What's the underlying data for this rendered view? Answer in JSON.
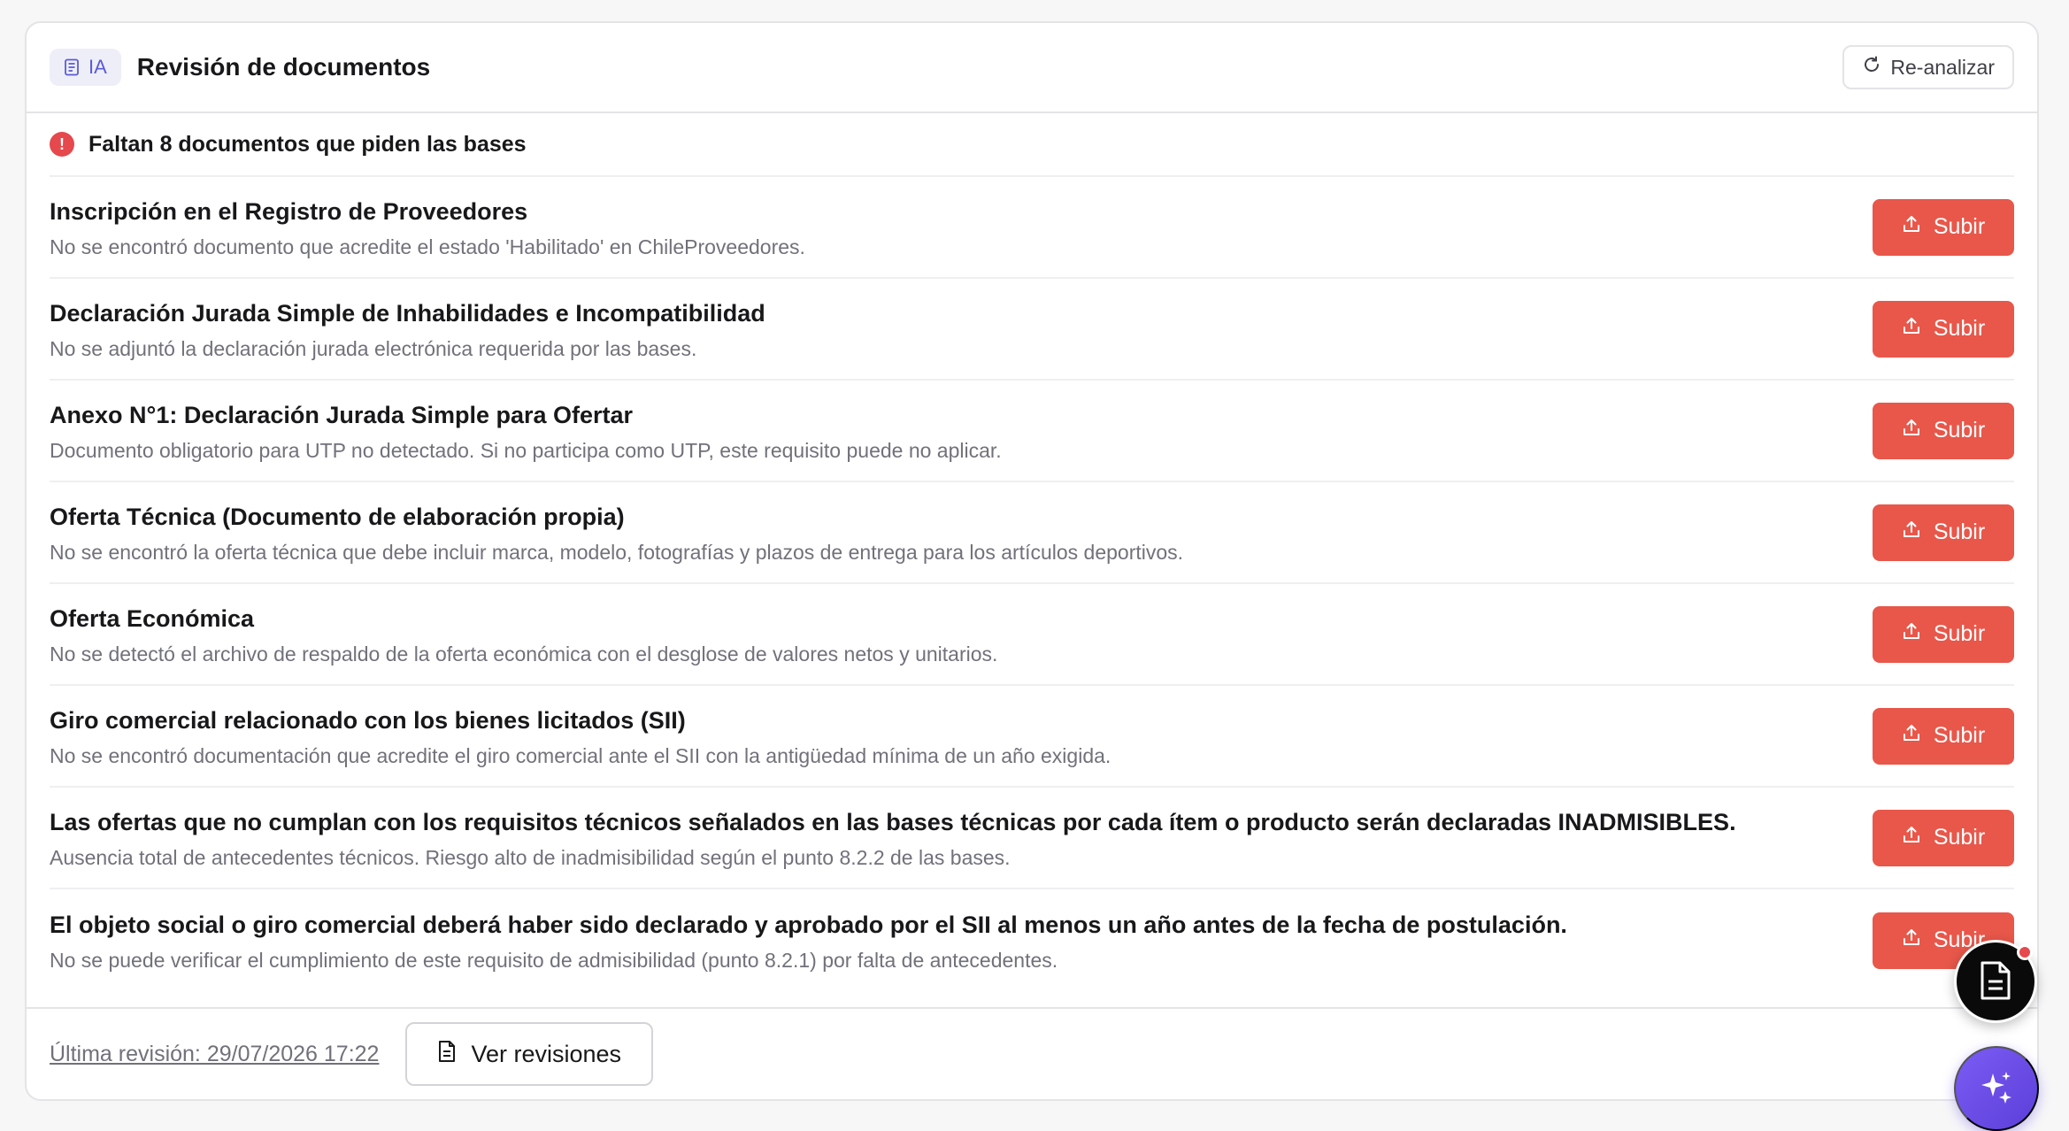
{
  "header": {
    "badge_label": "IA",
    "title": "Revisión de documentos",
    "reanalyze_label": "Re-analizar"
  },
  "alert": {
    "text": "Faltan 8 documentos que piden las bases",
    "icon": "exclamation",
    "color": "#e5484d"
  },
  "upload_label": "Subir",
  "accent_color": "#e8574a",
  "documents": [
    {
      "title": "Inscripción en el Registro de Proveedores",
      "description": "No se encontró documento que acredite el estado 'Habilitado' en ChileProveedores."
    },
    {
      "title": "Declaración Jurada Simple de Inhabilidades e Incompatibilidad",
      "description": "No se adjuntó la declaración jurada electrónica requerida por las bases."
    },
    {
      "title": "Anexo N°1: Declaración Jurada Simple para Ofertar",
      "description": "Documento obligatorio para UTP no detectado. Si no participa como UTP, este requisito puede no aplicar."
    },
    {
      "title": "Oferta Técnica (Documento de elaboración propia)",
      "description": "No se encontró la oferta técnica que debe incluir marca, modelo, fotografías y plazos de entrega para los artículos deportivos."
    },
    {
      "title": "Oferta Económica",
      "description": "No se detectó el archivo de respaldo de la oferta económica con el desglose de valores netos y unitarios."
    },
    {
      "title": "Giro comercial relacionado con los bienes licitados (SII)",
      "description": "No se encontró documentación que acredite el giro comercial ante el SII con la antigüedad mínima de un año exigida."
    },
    {
      "title": "Las ofertas que no cumplan con los requisitos técnicos señalados en las bases técnicas por cada ítem o producto serán declaradas INADMISIBLES.",
      "description": "Ausencia total de antecedentes técnicos. Riesgo alto de inadmisibilidad según el punto 8.2.2 de las bases."
    },
    {
      "title": "El objeto social o giro comercial deberá haber sido declarado y aprobado por el SII al menos un año antes de la fecha de postulación.",
      "description": "No se puede verificar el cumplimiento de este requisito de admisibilidad (punto 8.2.1) por falta de antecedentes."
    }
  ],
  "footer": {
    "last_review": "Última revisión: 29/07/2026 17:22",
    "view_revisions_label": "Ver revisiones"
  },
  "fabs": {
    "document_icon": "document-icon",
    "ai_icon": "sparkles-icon",
    "ai_gradient": [
      "#7c5cf5",
      "#5b3fd8"
    ]
  }
}
